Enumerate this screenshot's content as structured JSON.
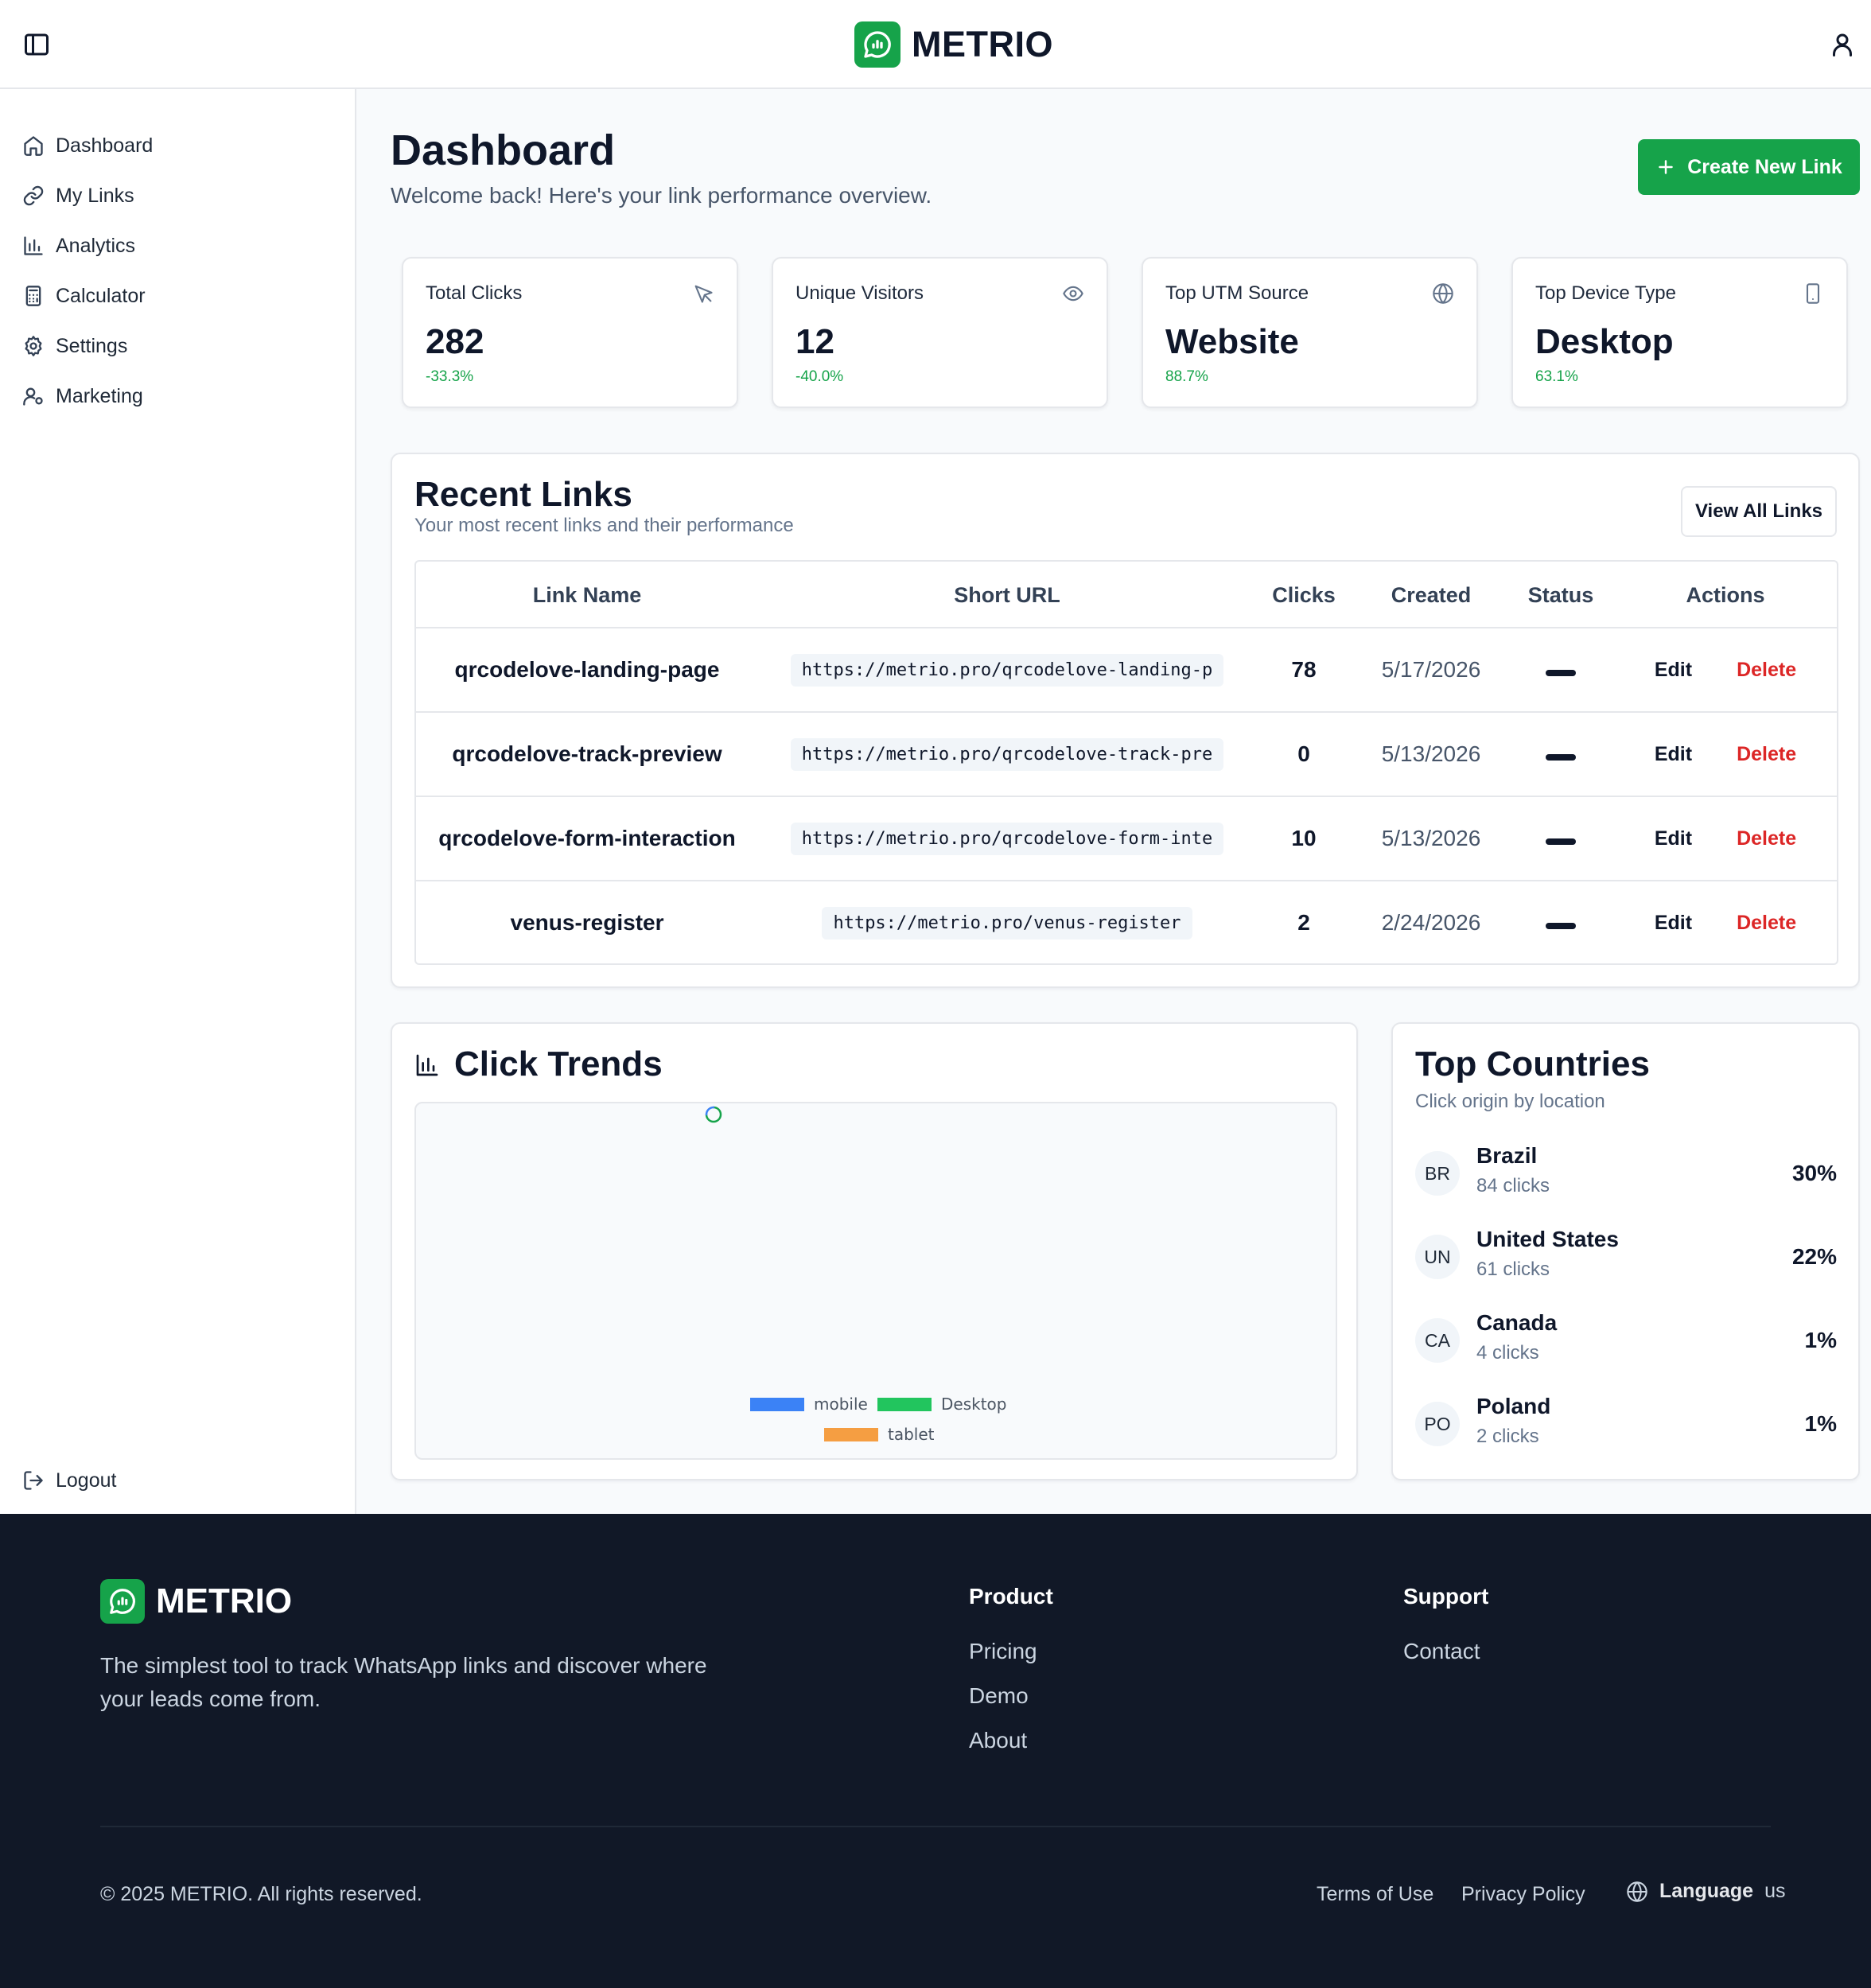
{
  "header": {
    "brand": "METRIO"
  },
  "sidebar": {
    "items": [
      {
        "label": "Dashboard",
        "icon": "home-icon"
      },
      {
        "label": "My Links",
        "icon": "link-icon"
      },
      {
        "label": "Analytics",
        "icon": "bar-chart-icon"
      },
      {
        "label": "Calculator",
        "icon": "calculator-icon"
      },
      {
        "label": "Settings",
        "icon": "gear-icon"
      },
      {
        "label": "Marketing",
        "icon": "user-icon"
      }
    ],
    "logout": "Logout"
  },
  "main": {
    "title": "Dashboard",
    "subtitle": "Welcome back! Here's your link performance overview.",
    "create_button": "Create New Link"
  },
  "stats": [
    {
      "label": "Total Clicks",
      "value": "282",
      "delta": "-33.3%",
      "icon": "cursor-icon"
    },
    {
      "label": "Unique Visitors",
      "value": "12",
      "delta": "-40.0%",
      "icon": "eye-icon"
    },
    {
      "label": "Top UTM Source",
      "value": "Website",
      "delta": "88.7%",
      "icon": "globe-icon"
    },
    {
      "label": "Top Device Type",
      "value": "Desktop",
      "delta": "63.1%",
      "icon": "smartphone-icon"
    }
  ],
  "recent_links": {
    "title": "Recent Links",
    "subtitle": "Your most recent links and their performance",
    "view_all": "View All Links",
    "columns": [
      "Link Name",
      "Short URL",
      "Clicks",
      "Created",
      "Status",
      "Actions"
    ],
    "rows": [
      {
        "name": "qrcodelove-landing-page",
        "url": "https://metrio.pro/qrcodelove-landing-p",
        "clicks": "78",
        "created": "5/17/2026"
      },
      {
        "name": "qrcodelove-track-preview",
        "url": "https://metrio.pro/qrcodelove-track-pre",
        "clicks": "0",
        "created": "5/13/2026"
      },
      {
        "name": "qrcodelove-form-interaction",
        "url": "https://metrio.pro/qrcodelove-form-inte",
        "clicks": "10",
        "created": "5/13/2026"
      },
      {
        "name": "venus-register",
        "url": "https://metrio.pro/venus-register",
        "clicks": "2",
        "created": "2/24/2026"
      }
    ],
    "edit_label": "Edit",
    "delete_label": "Delete"
  },
  "click_trends": {
    "title": "Click Trends",
    "legend": [
      {
        "name": "mobile",
        "color": "#3b82f6"
      },
      {
        "name": "Desktop",
        "color": "#22c55e"
      },
      {
        "name": "tablet",
        "color": "#f59e42"
      }
    ]
  },
  "top_countries": {
    "title": "Top Countries",
    "subtitle": "Click origin by location",
    "items": [
      {
        "code": "BR",
        "name": "Brazil",
        "clicks": "84 clicks",
        "pct": "30%"
      },
      {
        "code": "UN",
        "name": "United States",
        "clicks": "61 clicks",
        "pct": "22%"
      },
      {
        "code": "CA",
        "name": "Canada",
        "clicks": "4 clicks",
        "pct": "1%"
      },
      {
        "code": "PO",
        "name": "Poland",
        "clicks": "2 clicks",
        "pct": "1%"
      }
    ]
  },
  "footer": {
    "brand": "METRIO",
    "description": "The simplest tool to track WhatsApp links and discover where your leads come from.",
    "product_heading": "Product",
    "product_links": [
      "Pricing",
      "Demo",
      "About"
    ],
    "support_heading": "Support",
    "support_links": [
      "Contact"
    ],
    "copyright": "© 2025 METRIO. All rights reserved.",
    "terms": "Terms of Use",
    "privacy": "Privacy Policy",
    "language_label": "Language",
    "language_code": "us"
  },
  "colors": {
    "accent": "#16a34a",
    "danger": "#dc2626",
    "footer_bg": "#111827"
  }
}
